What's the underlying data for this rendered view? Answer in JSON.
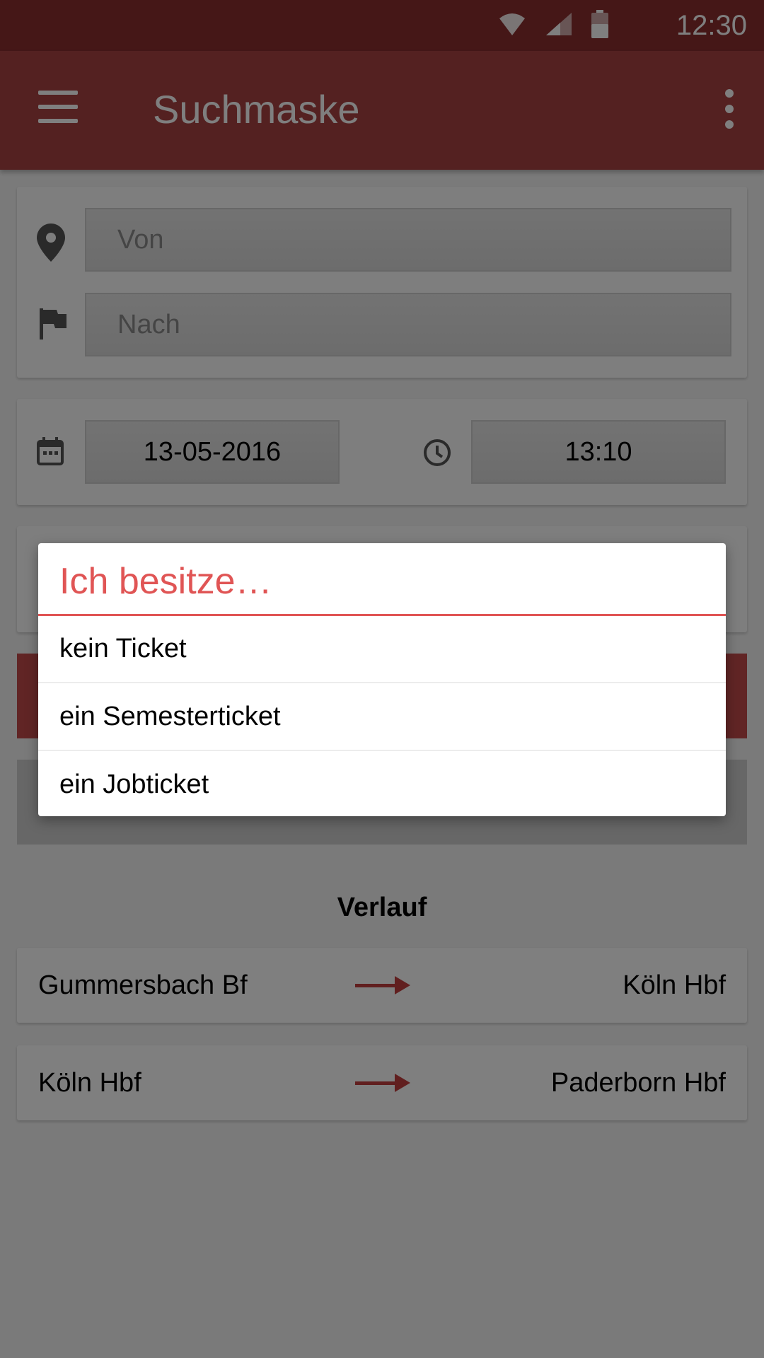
{
  "status_bar": {
    "time": "12:30"
  },
  "app_bar": {
    "title": "Suchmaske"
  },
  "route": {
    "from_placeholder": "Von",
    "to_placeholder": "Nach"
  },
  "datetime": {
    "date": "13-05-2016",
    "time": "13:10"
  },
  "history": {
    "title": "Verlauf",
    "items": [
      {
        "from": "Gummersbach Bf",
        "to": "Köln Hbf"
      },
      {
        "from": "Köln Hbf",
        "to": "Paderborn Hbf"
      }
    ]
  },
  "dialog": {
    "title": "Ich besitze…",
    "options": [
      "kein Ticket",
      "ein Semesterticket",
      "ein Jobticket"
    ]
  },
  "colors": {
    "primary": "#a84243",
    "status_bar": "#8a2e2f",
    "accent": "#e05555"
  }
}
